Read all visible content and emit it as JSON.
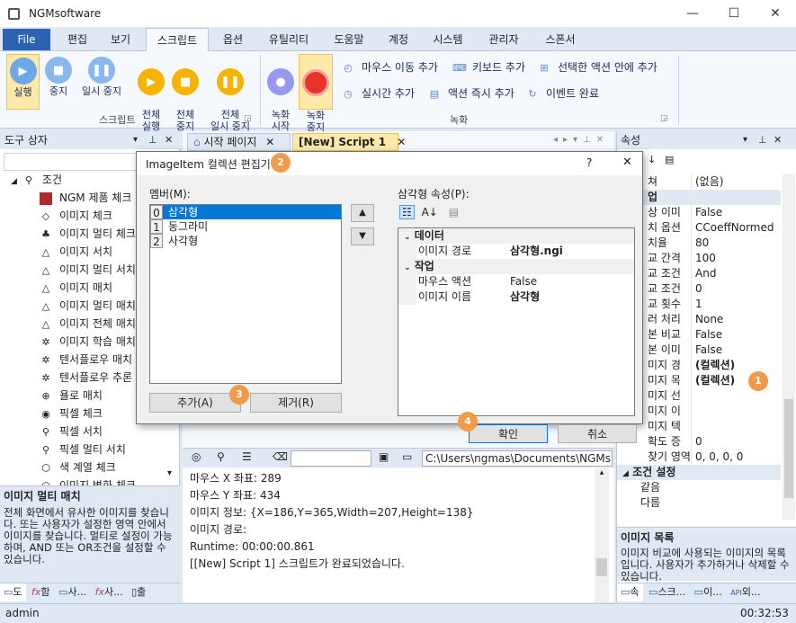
{
  "app": {
    "title": "NGMsoftware",
    "minimize": "—",
    "maximize": "☐",
    "close": "✕"
  },
  "menu": {
    "file": "File",
    "items": [
      "편집",
      "보기",
      "스크립트",
      "옵션",
      "유틸리티",
      "도움말",
      "계정",
      "시스템",
      "관리자",
      "스폰서"
    ]
  },
  "ribbon": {
    "run": "실행",
    "stop": "중지",
    "pause": "일시 중지",
    "run_all": "전체\n실행",
    "stop_all": "전체\n중지",
    "pause_all": "전체\n일시 중지",
    "script_group": "스크립트",
    "rec_start": "녹화\n시작",
    "rec_stop": "녹화\n중지",
    "mouse_move": "마우스 이동 추가",
    "keyboard": "키보드 추가",
    "selected_action": "선택한 액션 안에 추가",
    "realtime": "실시간 추가",
    "action_now": "액션 즉시 추가",
    "event_done": "이벤트 완료",
    "rec_group": "녹화"
  },
  "toolbox": {
    "title": "도구 상자",
    "root": "조건",
    "items": [
      "NGM 제품 체크",
      "이미지 체크",
      "이미지 멀티 체크",
      "이미지 서치",
      "이미지 멀티 서치",
      "이미지 매치",
      "이미지 멀티 매치",
      "이미지 전체 매치",
      "이미지 학습 매치",
      "텐서플로우 매치",
      "텐서플로우 추론",
      "욜로 매치",
      "픽셀 체크",
      "픽셀 서치",
      "픽셀 멀티 서치",
      "색 계열 체크",
      "이미지 변화 체크"
    ],
    "desc_title": "이미지 멀티 매치",
    "desc_text": "전체 화면에서 유사한 이미지를 찾습니다. 또는 사용자가 설정한 영역 안에서 이미지를 찾습니다. 멀티로 설정이 가능하며, AND 또는 OR조건을 설정할 수 있습니다.",
    "bottom_tabs": [
      "도",
      "함",
      "사...",
      "사...",
      "출"
    ]
  },
  "doc_tabs": {
    "start_page": "시작 페이지",
    "script": "[New] Script 1"
  },
  "path": "C:\\Users\\ngmas\\Documents\\NGMs",
  "output": [
    "마우스 X 좌표: 289",
    "마우스 Y 좌표: 434",
    "이미지 정보: {X=186,Y=365,Width=207,Height=138}",
    "이미지 경로:",
    "Runtime: 00:00:00.861",
    "[[New] Script 1] 스크립트가 완료되었습니다."
  ],
  "properties": {
    "title": "속성",
    "rows": [
      {
        "k": "쳐",
        "v": "(없음)"
      },
      {
        "k": "업",
        "v": "",
        "cat": true
      },
      {
        "k": "상 이미",
        "v": "False"
      },
      {
        "k": "치 옵션",
        "v": "CCoeffNormed"
      },
      {
        "k": "치율",
        "v": "80"
      },
      {
        "k": "교 간격",
        "v": "100"
      },
      {
        "k": "교 조건",
        "v": "And"
      },
      {
        "k": "교 조건",
        "v": "0"
      },
      {
        "k": "교 횟수",
        "v": "1"
      },
      {
        "k": "러 처리",
        "v": "None"
      },
      {
        "k": "본 비교",
        "v": "False"
      },
      {
        "k": "본 이미",
        "v": "False"
      },
      {
        "k": "미지 경",
        "v": "(컬렉션)",
        "bold": true
      },
      {
        "k": "미지 목",
        "v": "(컬렉션)",
        "bold": true
      },
      {
        "k": "미지 선",
        "v": ""
      },
      {
        "k": "미지 이",
        "v": ""
      },
      {
        "k": "미지 텍",
        "v": ""
      },
      {
        "k": "확도 증",
        "v": "0"
      },
      {
        "k": "찾기 영역",
        "v": "0, 0, 0, 0"
      }
    ],
    "cond_header": "조건 설정",
    "cond_rows": [
      {
        "k": "같음",
        "v": ""
      },
      {
        "k": "다름",
        "v": ""
      }
    ],
    "desc_title": "이미지 목록",
    "desc_text": "이미지 비교에 사용되는 이미지의 목록입니다. 사용자가 추가하거나 삭제할 수 있습니다.",
    "bottom_tabs": [
      "속",
      "스크...",
      "이...",
      "외..."
    ]
  },
  "dialog": {
    "title": "ImageItem 컬렉션 편집기",
    "help": "?",
    "close": "✕",
    "members_label": "멤버(M):",
    "members": [
      {
        "i": "0",
        "n": "삼각형"
      },
      {
        "i": "1",
        "n": "동그라미"
      },
      {
        "i": "2",
        "n": "사각형"
      }
    ],
    "props_label": "삼각형 속성(P):",
    "cat_data": "데이터",
    "path_key": "이미지 경로",
    "path_val": "삼각형.ngi",
    "cat_work": "작업",
    "mouse_key": "마우스 액션",
    "mouse_val": "False",
    "name_key": "이미지 이름",
    "name_val": "삼각형",
    "add": "추가(A)",
    "remove": "제거(R)",
    "ok": "확인",
    "cancel": "취소",
    "up": "▲",
    "down": "▼"
  },
  "badges": [
    "1",
    "2",
    "3",
    "4"
  ],
  "status": {
    "user": "admin",
    "time": "00:32:53"
  }
}
